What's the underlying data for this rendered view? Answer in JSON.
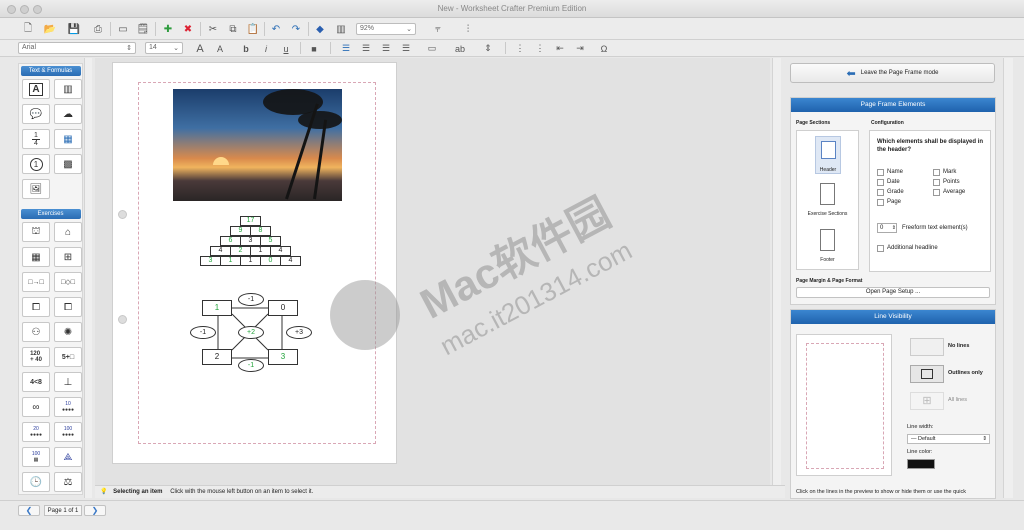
{
  "window": {
    "title": "New  - Worksheet Crafter Premium Edition"
  },
  "toolbar": {
    "zoom": "92%",
    "font": "Arial",
    "font_size": "14",
    "bold": "b",
    "italic": "i",
    "underline": "u",
    "omega": "Ω"
  },
  "left_panel": {
    "text_formulas_header": "Text & Formulas",
    "exercises_header": "Exercises",
    "fraction_top": "1",
    "fraction_bottom": "4",
    "circled_one": "1",
    "numberline": "120\n+ 40",
    "five_plus": "5+□",
    "less_than": "4<8",
    "ten": "10",
    "twenty": "20",
    "hundred": "100",
    "hundred2": "100"
  },
  "pyramid": {
    "rows": [
      [
        "17"
      ],
      [
        "9",
        "8"
      ],
      [
        "6",
        "3",
        "5"
      ],
      [
        "4",
        "2",
        "1",
        "4"
      ],
      [
        "3",
        "1",
        "1",
        "0",
        "4"
      ]
    ],
    "green": [
      [
        true
      ],
      [
        true,
        true
      ],
      [
        true,
        false,
        true
      ],
      [
        false,
        true,
        false,
        false
      ],
      [
        true,
        true,
        false,
        true,
        false
      ]
    ]
  },
  "arithmagon": {
    "nodes": {
      "top_left": "1",
      "top_right": "0",
      "bottom_left": "2",
      "bottom_right": "3"
    },
    "ovals": {
      "top": "-1",
      "left": "-1",
      "center": "+2",
      "right": "+3",
      "bottom": "-1"
    }
  },
  "right_panel": {
    "leave_button": "Leave the Page Frame mode",
    "page_frame_header": "Page Frame Elements",
    "page_sections_label": "Page Sections",
    "configuration_label": "Configuration",
    "header_label": "Header",
    "exercise_sections_label": "Exercise Sections",
    "footer_label": "Footer",
    "question": "Which elements shall be displayed in the header?",
    "checkboxes": [
      "Name",
      "Mark",
      "Date",
      "Points",
      "Grade",
      "Average",
      "Page"
    ],
    "freeform_value": "0",
    "freeform_label": "Freeform text element(s)",
    "additional_headline": "Additional headline",
    "page_margin_label": "Page Margin & Page Format",
    "open_page_setup": "Open Page Setup ...",
    "line_visibility_header": "Line Visibility",
    "no_lines": "No lines",
    "outlines_only": "Outlines only",
    "all_lines": "All lines",
    "line_width_label": "Line width:",
    "line_width_value": "— Default",
    "line_color_label": "Line color:",
    "hint": "Click on the lines in the preview to show or hide them or use the quick"
  },
  "status": {
    "title": "Selecting an item",
    "text": "Click with the mouse left button on an item to select it."
  },
  "page_nav": {
    "label": "Page 1 of 1",
    "prev": "❮",
    "next": "❯"
  },
  "watermark": {
    "brand": "Mac软件园",
    "url": "mac.it201314.com"
  }
}
